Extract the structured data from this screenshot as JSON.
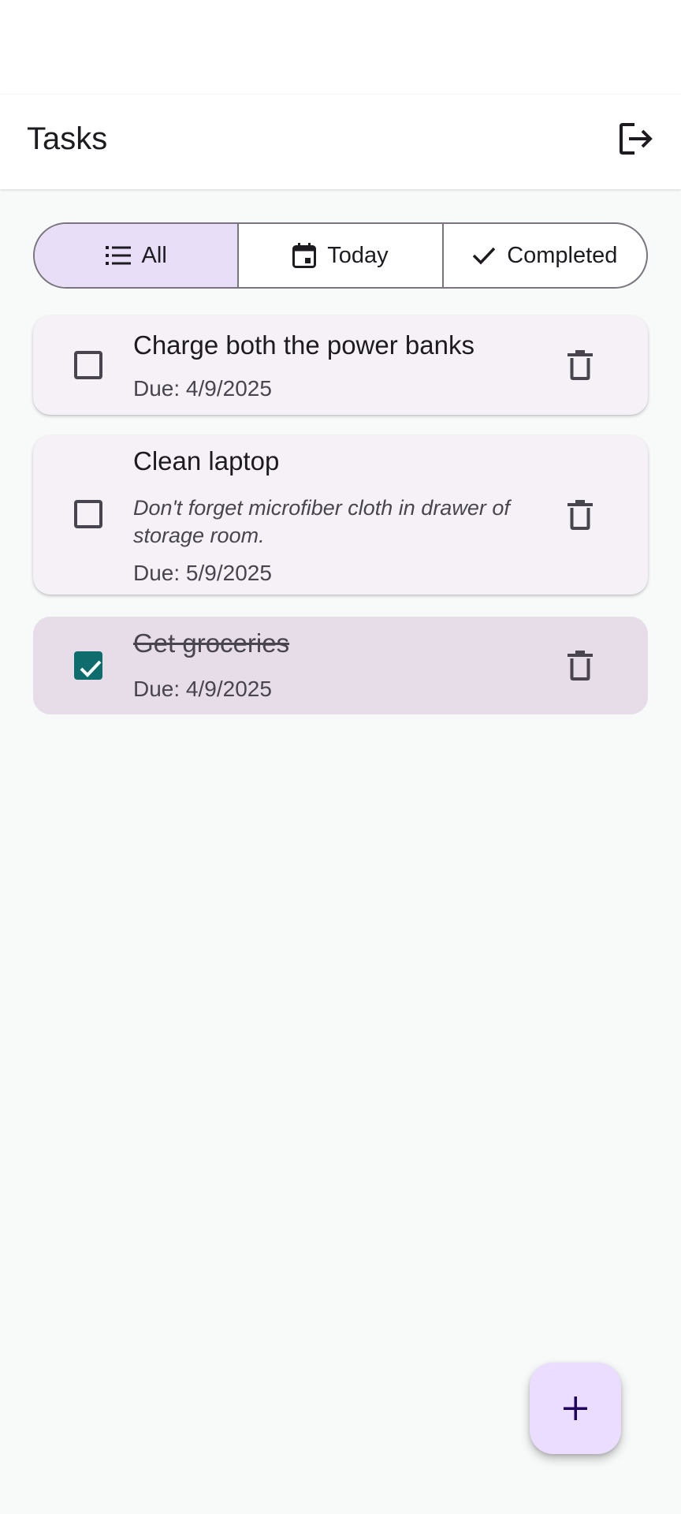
{
  "app_bar": {
    "title": "Tasks",
    "logout_icon": "logout-icon"
  },
  "filters": [
    {
      "label": "All",
      "icon": "list-icon",
      "selected": true
    },
    {
      "label": "Today",
      "icon": "calendar-icon",
      "selected": false
    },
    {
      "label": "Completed",
      "icon": "check-icon",
      "selected": false
    }
  ],
  "tasks": [
    {
      "title": "Charge both the power banks",
      "description": "",
      "due": "Due: 4/9/2025",
      "completed": false
    },
    {
      "title": "Clean laptop",
      "description": "Don't forget microfiber cloth in drawer of storage room.",
      "due": "Due: 5/9/2025",
      "completed": false
    },
    {
      "title": "Get groceries",
      "description": "",
      "due": "Due: 4/9/2025",
      "completed": true
    }
  ],
  "fab": {
    "icon": "add-icon"
  },
  "colors": {
    "selected_segment": "#e8def8",
    "card": "#f5f1f6",
    "card_completed": "#e6dde8",
    "checkbox_checked": "#0f6c6c",
    "fab": "#eaddff"
  }
}
